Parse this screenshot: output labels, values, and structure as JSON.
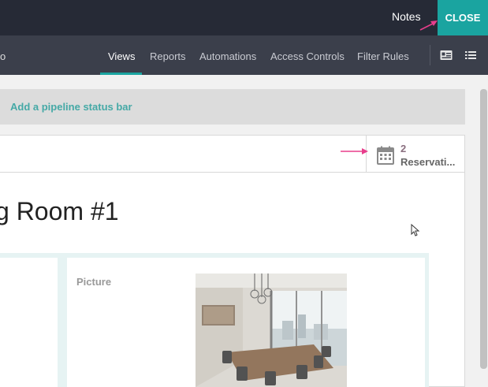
{
  "topbar": {
    "notes_label": "Notes",
    "close_label": "CLOSE"
  },
  "navbar": {
    "crumb_tail": "o",
    "tabs": [
      {
        "label": "Views",
        "active": true
      },
      {
        "label": "Reports"
      },
      {
        "label": "Automations"
      },
      {
        "label": "Access Controls"
      },
      {
        "label": "Filter Rules"
      }
    ],
    "icons": [
      "form-view-icon",
      "list-view-icon"
    ]
  },
  "pipeline": {
    "label": "Add a pipeline status bar"
  },
  "stat_button": {
    "count": "2",
    "label": "Reservati..."
  },
  "record": {
    "title": "g Room #1"
  },
  "fields": {
    "picture_label": "Picture"
  },
  "colors": {
    "accent": "#1aa4a0",
    "annotation": "#e83e8c",
    "topbar": "#262a36",
    "navbar": "#3b3f4b"
  }
}
